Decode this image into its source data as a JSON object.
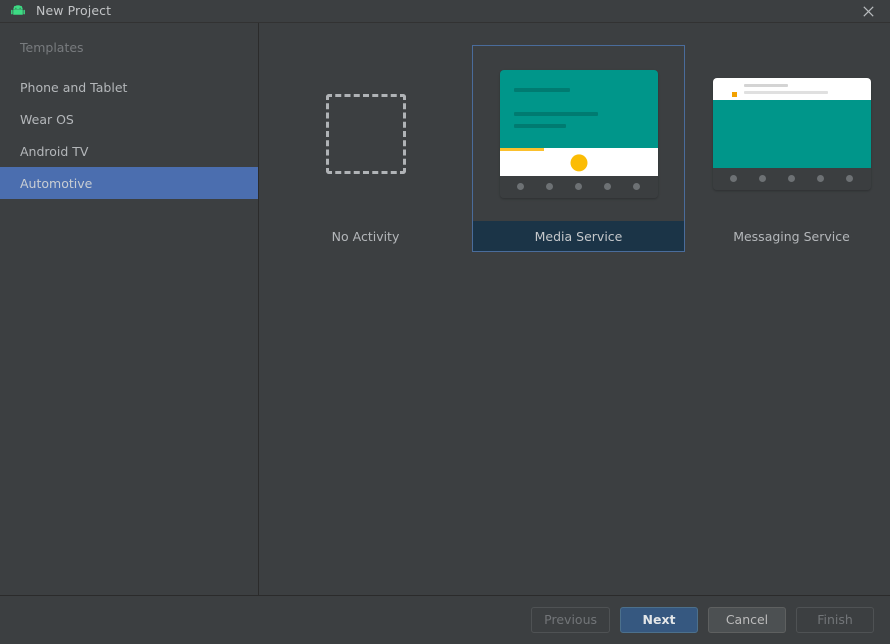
{
  "window": {
    "title": "New Project",
    "app_icon": "android-robot-icon",
    "close_icon": "close-icon"
  },
  "sidebar": {
    "header": "Templates",
    "items": [
      {
        "label": "Phone and Tablet",
        "selected": false
      },
      {
        "label": "Wear OS",
        "selected": false
      },
      {
        "label": "Android TV",
        "selected": false
      },
      {
        "label": "Automotive",
        "selected": true
      }
    ]
  },
  "templates": [
    {
      "label": "No Activity",
      "selected": false,
      "thumb": "dashed-placeholder-thumbnail"
    },
    {
      "label": "Media Service",
      "selected": true,
      "thumb": "media-service-thumbnail"
    },
    {
      "label": "Messaging Service",
      "selected": false,
      "thumb": "messaging-service-thumbnail"
    }
  ],
  "footer": {
    "buttons": [
      {
        "label": "Previous",
        "state": "disabled"
      },
      {
        "label": "Next",
        "state": "primary"
      },
      {
        "label": "Cancel",
        "state": "normal"
      },
      {
        "label": "Finish",
        "state": "disabled"
      }
    ]
  },
  "colors": {
    "background": "#3c3f41",
    "selection_blue": "#4b6eaf",
    "selected_label_bg": "#1b3447",
    "selected_card_border": "#4a6c9b",
    "primary_button": "#365880",
    "teal_accent": "#00968a",
    "yellow_accent": "#fbbc05",
    "android_green": "#3ddc84"
  }
}
